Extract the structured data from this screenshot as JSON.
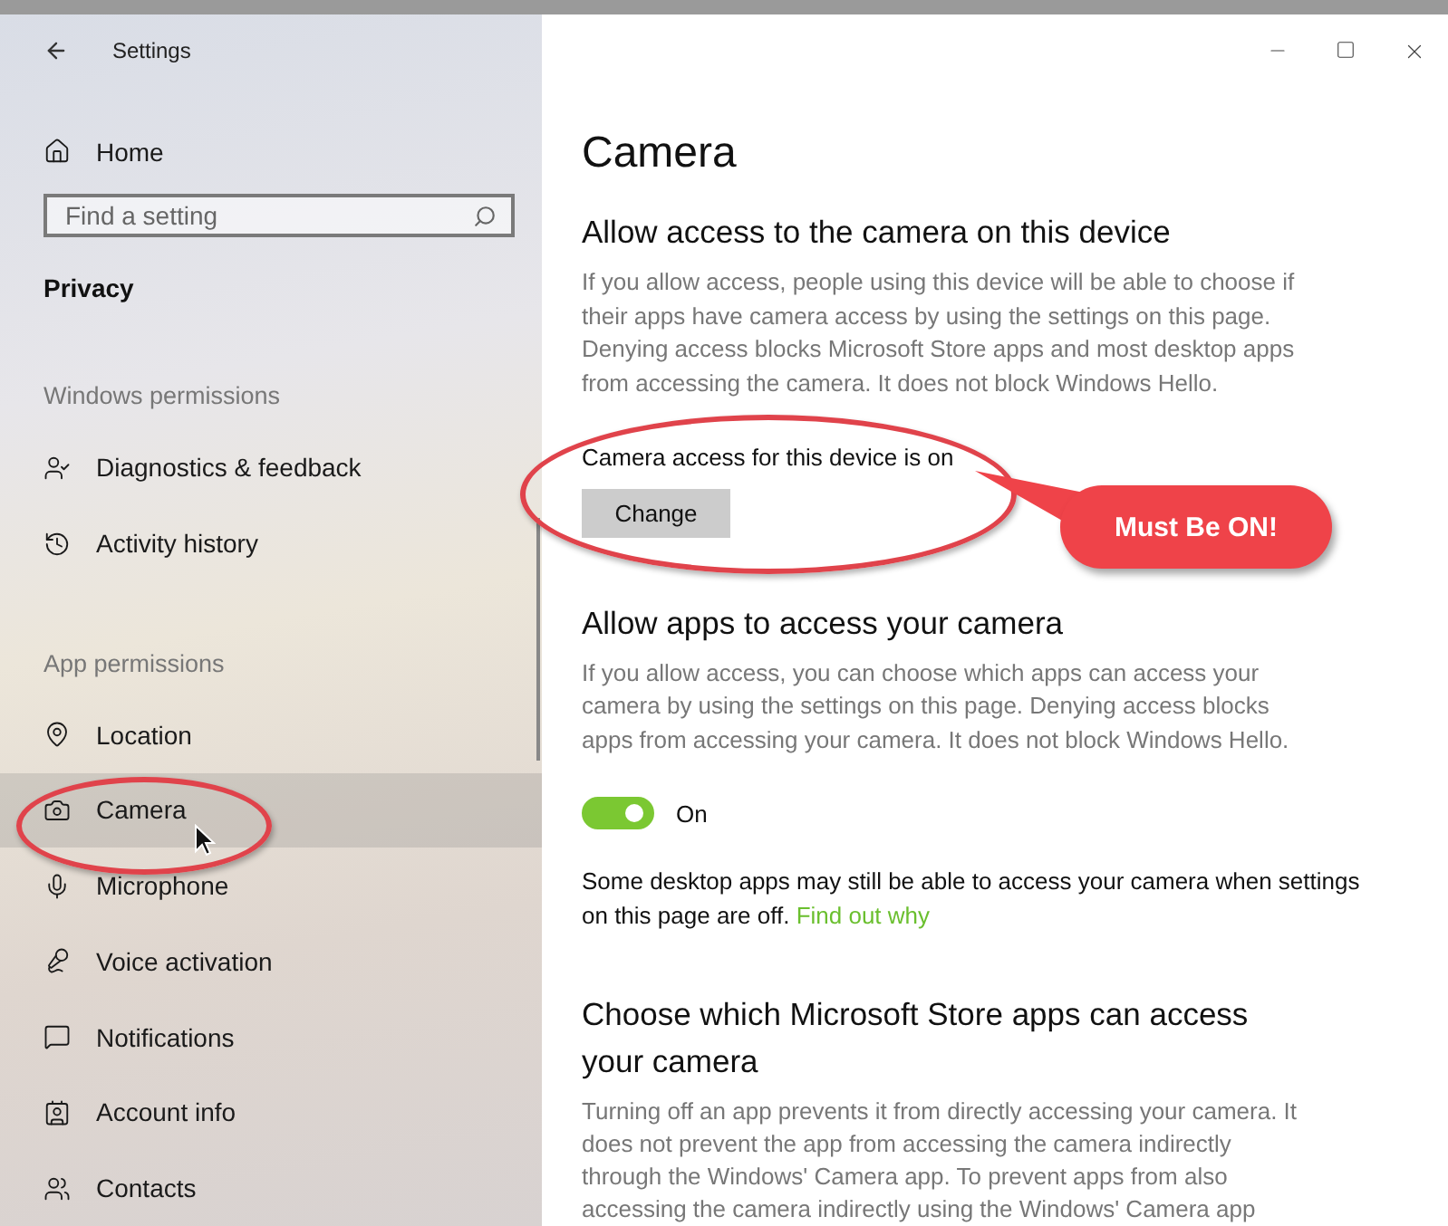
{
  "window": {
    "title": "Settings"
  },
  "sidebar": {
    "home": "Home",
    "search": {
      "placeholder": "Find a setting"
    },
    "section": "Privacy",
    "groups": [
      {
        "label": "Windows permissions",
        "items": [
          {
            "label": "Diagnostics & feedback",
            "kind": "diagnostics",
            "selected": false
          },
          {
            "label": "Activity history",
            "kind": "history",
            "selected": false
          }
        ]
      },
      {
        "label": "App permissions",
        "items": [
          {
            "label": "Location",
            "kind": "location",
            "selected": false
          },
          {
            "label": "Camera",
            "kind": "camera",
            "selected": true
          },
          {
            "label": "Microphone",
            "kind": "microphone",
            "selected": false
          },
          {
            "label": "Voice activation",
            "kind": "voice",
            "selected": false
          },
          {
            "label": "Notifications",
            "kind": "notifications",
            "selected": false
          },
          {
            "label": "Account info",
            "kind": "account",
            "selected": false
          },
          {
            "label": "Contacts",
            "kind": "contacts",
            "selected": false
          }
        ]
      }
    ]
  },
  "page": {
    "title": "Camera",
    "device_access": {
      "heading": "Allow access to the camera on this device",
      "description": "If you allow access, people using this device will be able to choose if their apps have camera access by using the settings on this page. Denying access blocks Microsoft Store apps and most desktop apps from accessing the camera. It does not block Windows Hello.",
      "status": "Camera access for this device is on",
      "button": "Change"
    },
    "app_access": {
      "heading": "Allow apps to access your camera",
      "description": "If you allow access, you can choose which apps can access your camera by using the settings on this page. Denying access blocks apps from accessing your camera. It does not block Windows Hello.",
      "toggle": {
        "on": true,
        "label": "On"
      },
      "note": "Some desktop apps may still be able to access your camera when settings on this page are off.",
      "link": "Find out why"
    },
    "store_apps": {
      "heading": "Choose which Microsoft Store apps can access your camera",
      "description": "Turning off an app prevents it from directly accessing your camera. It does not prevent the app from accessing the camera indirectly through the Windows' Camera app. To prevent apps from also accessing the camera indirectly using the Windows' Camera app"
    }
  },
  "callout": "Must Be ON!"
}
